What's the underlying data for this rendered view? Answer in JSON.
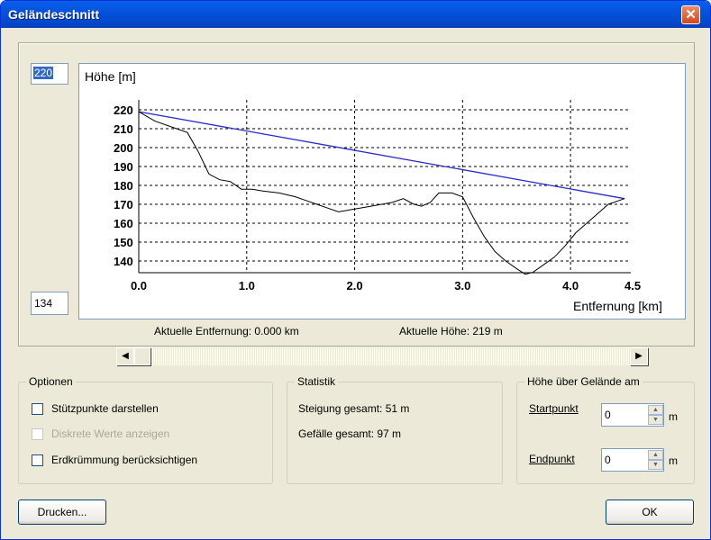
{
  "window": {
    "title": "Geländeschnitt",
    "close_glyph": "✕"
  },
  "fields": {
    "max_height": "220",
    "min_height": "134"
  },
  "plot": {
    "y_label": "Höhe [m]",
    "x_label": "Entfernung [km]",
    "x_ticks": [
      "0.0",
      "1.0",
      "2.0",
      "3.0",
      "4.0",
      "4.5"
    ],
    "y_ticks": [
      "220",
      "210",
      "200",
      "190",
      "180",
      "170",
      "160",
      "150",
      "140"
    ],
    "line_colors": {
      "sightline": "#2a2acc",
      "terrain": "#000000"
    }
  },
  "chart_data": {
    "type": "line",
    "xlim": [
      0,
      4.5
    ],
    "ylim": [
      134,
      220
    ],
    "series": [
      {
        "x": [
          0,
          4.5
        ],
        "values": [
          219,
          173
        ]
      },
      {
        "x": [
          0.0,
          0.15,
          0.3,
          0.45,
          0.55,
          0.65,
          0.75,
          0.85,
          0.95,
          1.05,
          1.15,
          1.3,
          1.45,
          1.55,
          1.65,
          1.75,
          1.85,
          1.95,
          2.05,
          2.15,
          2.25,
          2.35,
          2.45,
          2.55,
          2.62,
          2.7,
          2.78,
          2.9,
          3.0,
          3.1,
          3.2,
          3.3,
          3.4,
          3.5,
          3.58,
          3.65,
          3.75,
          3.85,
          3.95,
          4.05,
          4.15,
          4.25,
          4.35,
          4.45,
          4.5
        ],
        "values": [
          219,
          214,
          211,
          208,
          198,
          186,
          183,
          182,
          178,
          178,
          177,
          176,
          174,
          172,
          170,
          168,
          166,
          167,
          168,
          169,
          170,
          171,
          173,
          170,
          169,
          171,
          176,
          176,
          174,
          163,
          153,
          145,
          140,
          136,
          133,
          134,
          138,
          142,
          148,
          155,
          160,
          165,
          170,
          172,
          173
        ]
      }
    ]
  },
  "status": {
    "distance": "Aktuelle Entfernung: 0.000 km",
    "height": "Aktuelle Höhe: 219 m"
  },
  "options": {
    "legend": "Optionen",
    "items": [
      "Stützpunkte darstellen",
      "Diskrete Werte anzeigen",
      "Erdkrümmung berücksichtigen"
    ]
  },
  "stats": {
    "legend": "Statistik",
    "ascent": "Steigung gesamt: 51 m",
    "descent": "Gefälle gesamt: 97 m"
  },
  "height_above": {
    "legend": "Höhe über Gelände am",
    "start_label": "Startpunkt",
    "start_value": "0",
    "start_unit": "m",
    "end_label": "Endpunkt",
    "end_value": "0",
    "end_unit": "m"
  },
  "buttons": {
    "print": "Drucken...",
    "ok": "OK"
  }
}
